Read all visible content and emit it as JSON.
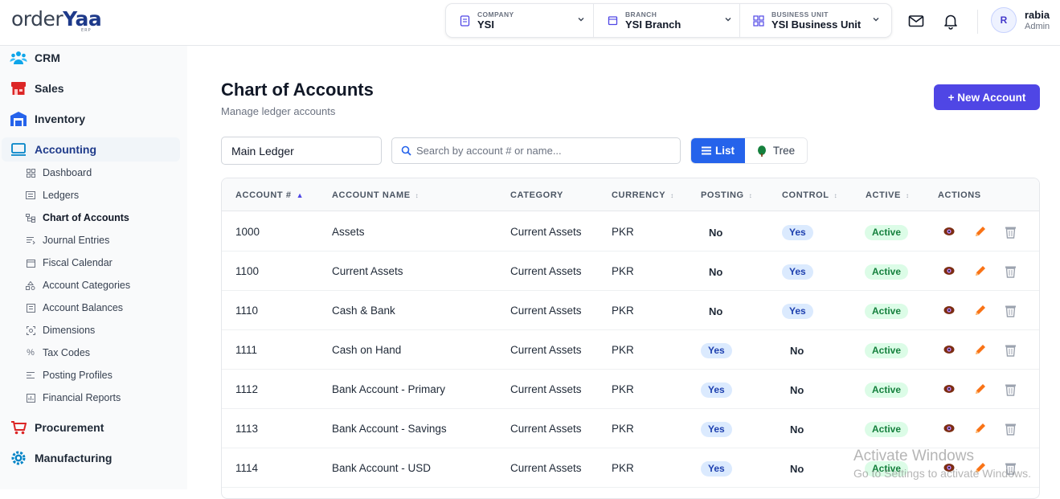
{
  "brand": {
    "logo_prefix": "order",
    "logo_suffix": "Yaa",
    "logo_sub": "ERP"
  },
  "context": [
    {
      "label": "COMPANY",
      "value": "YSI",
      "icon": "document-icon"
    },
    {
      "label": "BRANCH",
      "value": "YSI Branch",
      "icon": "store-icon"
    },
    {
      "label": "BUSINESS UNIT",
      "value": "YSI Business Unit",
      "icon": "grid-icon"
    }
  ],
  "user": {
    "initial": "R",
    "name": "rabia",
    "role": "Admin"
  },
  "sidebar": {
    "modules": [
      {
        "label": "CRM",
        "icon": "crm-icon"
      },
      {
        "label": "Sales",
        "icon": "shop-icon"
      },
      {
        "label": "Inventory",
        "icon": "warehouse-icon"
      },
      {
        "label": "Accounting",
        "icon": "accounting-icon"
      },
      {
        "label": "Procurement",
        "icon": "cart-icon"
      },
      {
        "label": "Manufacturing",
        "icon": "gear-icon"
      }
    ],
    "accounting_items": [
      {
        "label": "Dashboard",
        "icon": "dashboard-icon"
      },
      {
        "label": "Ledgers",
        "icon": "ledger-icon"
      },
      {
        "label": "Chart of Accounts",
        "icon": "hierarchy-icon"
      },
      {
        "label": "Journal Entries",
        "icon": "journal-icon"
      },
      {
        "label": "Fiscal Calendar",
        "icon": "calendar-icon"
      },
      {
        "label": "Account Categories",
        "icon": "categories-icon"
      },
      {
        "label": "Account Balances",
        "icon": "balance-icon"
      },
      {
        "label": "Dimensions",
        "icon": "dimensions-icon"
      },
      {
        "label": "Tax Codes",
        "icon": "percent-icon"
      },
      {
        "label": "Posting Profiles",
        "icon": "profiles-icon"
      },
      {
        "label": "Financial Reports",
        "icon": "report-icon"
      }
    ]
  },
  "page": {
    "title": "Chart of Accounts",
    "subtitle": "Manage ledger accounts",
    "new_button": "+ New Account"
  },
  "filters": {
    "ledger": "Main Ledger",
    "search_placeholder": "Search by account # or name...",
    "view_list": "List",
    "view_tree": "Tree"
  },
  "table": {
    "columns": [
      "ACCOUNT #",
      "ACCOUNT NAME",
      "CATEGORY",
      "CURRENCY",
      "POSTING",
      "CONTROL",
      "ACTIVE",
      "ACTIONS"
    ],
    "rows": [
      {
        "number": "1000",
        "name": "Assets",
        "category": "Current Assets",
        "currency": "PKR",
        "posting": "No",
        "control": "Yes",
        "active": "Active"
      },
      {
        "number": "1100",
        "name": "Current Assets",
        "category": "Current Assets",
        "currency": "PKR",
        "posting": "No",
        "control": "Yes",
        "active": "Active"
      },
      {
        "number": "1110",
        "name": "Cash & Bank",
        "category": "Current Assets",
        "currency": "PKR",
        "posting": "No",
        "control": "Yes",
        "active": "Active"
      },
      {
        "number": "1111",
        "name": "Cash on Hand",
        "category": "Current Assets",
        "currency": "PKR",
        "posting": "Yes",
        "control": "No",
        "active": "Active"
      },
      {
        "number": "1112",
        "name": "Bank Account - Primary",
        "category": "Current Assets",
        "currency": "PKR",
        "posting": "Yes",
        "control": "No",
        "active": "Active"
      },
      {
        "number": "1113",
        "name": "Bank Account - Savings",
        "category": "Current Assets",
        "currency": "PKR",
        "posting": "Yes",
        "control": "No",
        "active": "Active"
      },
      {
        "number": "1114",
        "name": "Bank Account - USD",
        "category": "Current Assets",
        "currency": "PKR",
        "posting": "Yes",
        "control": "No",
        "active": "Active"
      }
    ]
  },
  "watermark": {
    "line1": "Activate Windows",
    "line2": "Go to Settings to activate Windows."
  },
  "colors": {
    "accent": "#4f46e5",
    "list_button": "#2563eb",
    "yes_bg": "#dbeafe",
    "active_bg": "#dcfce7"
  }
}
